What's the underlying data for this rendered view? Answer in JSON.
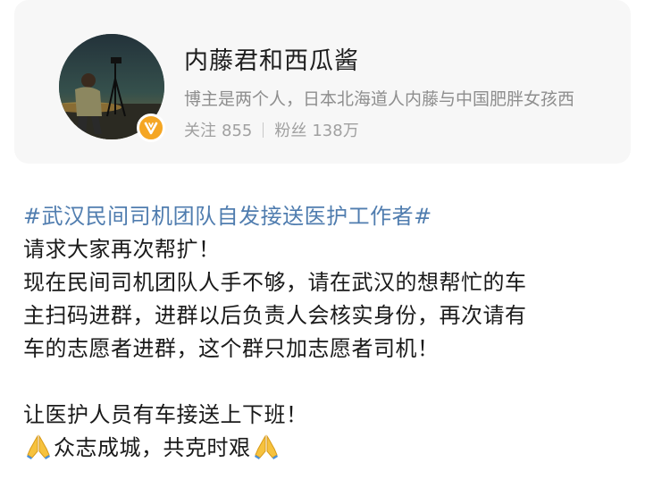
{
  "profile": {
    "username": "内藤君和西瓜酱",
    "bio": "博主是两个人，日本北海道人内藤与中国肥胖女孩西",
    "following_label": "关注",
    "following_count": "855",
    "followers_label": "粉丝",
    "followers_count": "138万",
    "avatar_icon": "avatar-photo",
    "badge_icon": "verified-v-icon",
    "badge_color": "#f5a623"
  },
  "post": {
    "topic": "#武汉民间司机团队自发接送医护工作者#",
    "line1": "请求大家再次帮扩！",
    "line2": "现在民间司机团队人手不够，请在武汉的想帮忙的车",
    "line3": "主扫码进群，进群以后负责人会核实身份，再次请有",
    "line4": "车的志愿者进群，这个群只加志愿者司机！",
    "line5": "让医护人员有车接送上下班！",
    "line6": "众志成城，共克时艰",
    "emoji_icon": "folded-hands-icon",
    "topic_color": "#507daf"
  }
}
